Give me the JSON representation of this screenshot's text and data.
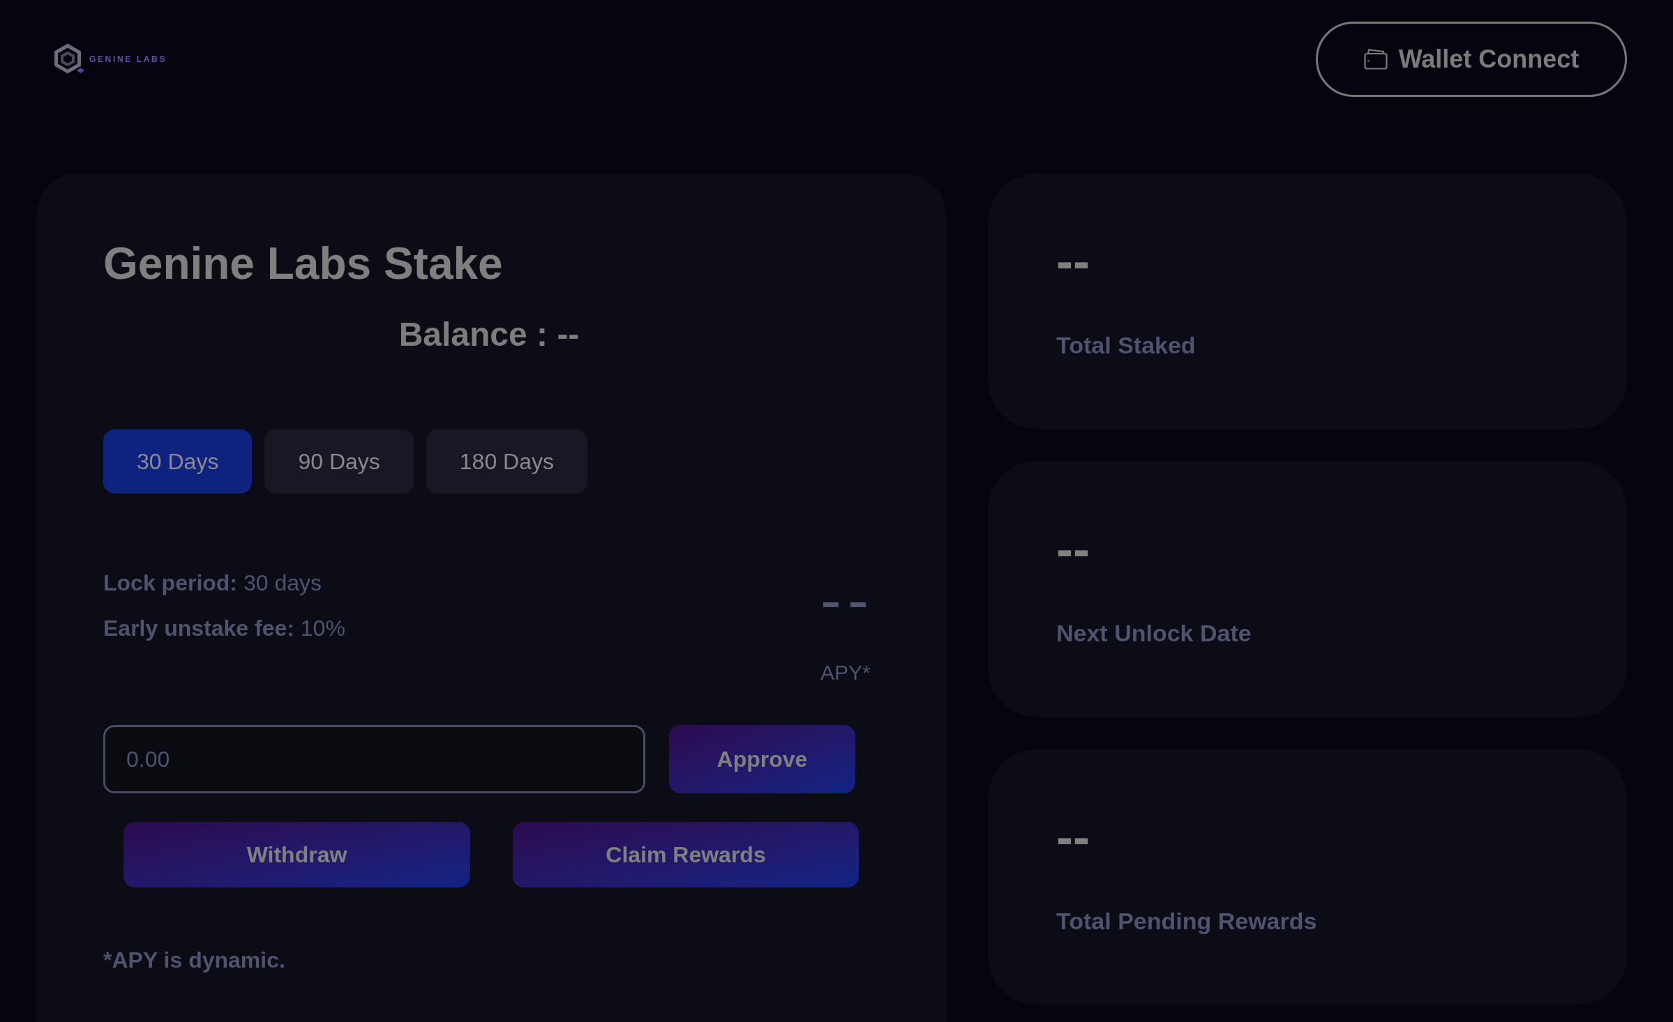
{
  "header": {
    "logo": {
      "text": "GENINE LABS"
    },
    "wallet_button": {
      "label": "Wallet Connect"
    }
  },
  "stake_card": {
    "title": "Genine Labs Stake",
    "balance": "Balance : --",
    "period_tabs": [
      {
        "label": "30 Days",
        "selected": true
      },
      {
        "label": "90 Days",
        "selected": false
      },
      {
        "label": "180 Days",
        "selected": false
      }
    ],
    "details": [
      "**Lock period:** 30 days",
      "**Early unstake fee:** 10%"
    ],
    "apy": {
      "value": "--",
      "label": "APY*"
    },
    "amount_input": {
      "placeholder": "0.00"
    },
    "approve_button": {
      "label": "Approve"
    },
    "withdraw_button": {
      "label": "Withdraw"
    },
    "claim_rewards_button": {
      "label": "Claim Rewards"
    },
    "footnote": "*APY is dynamic."
  },
  "stats": [
    {
      "value": "--",
      "label": "Total Staked"
    },
    {
      "value": "--",
      "label": "Next Unlock Date"
    },
    {
      "value": "--",
      "label": "Total Pending Rewards"
    }
  ]
}
